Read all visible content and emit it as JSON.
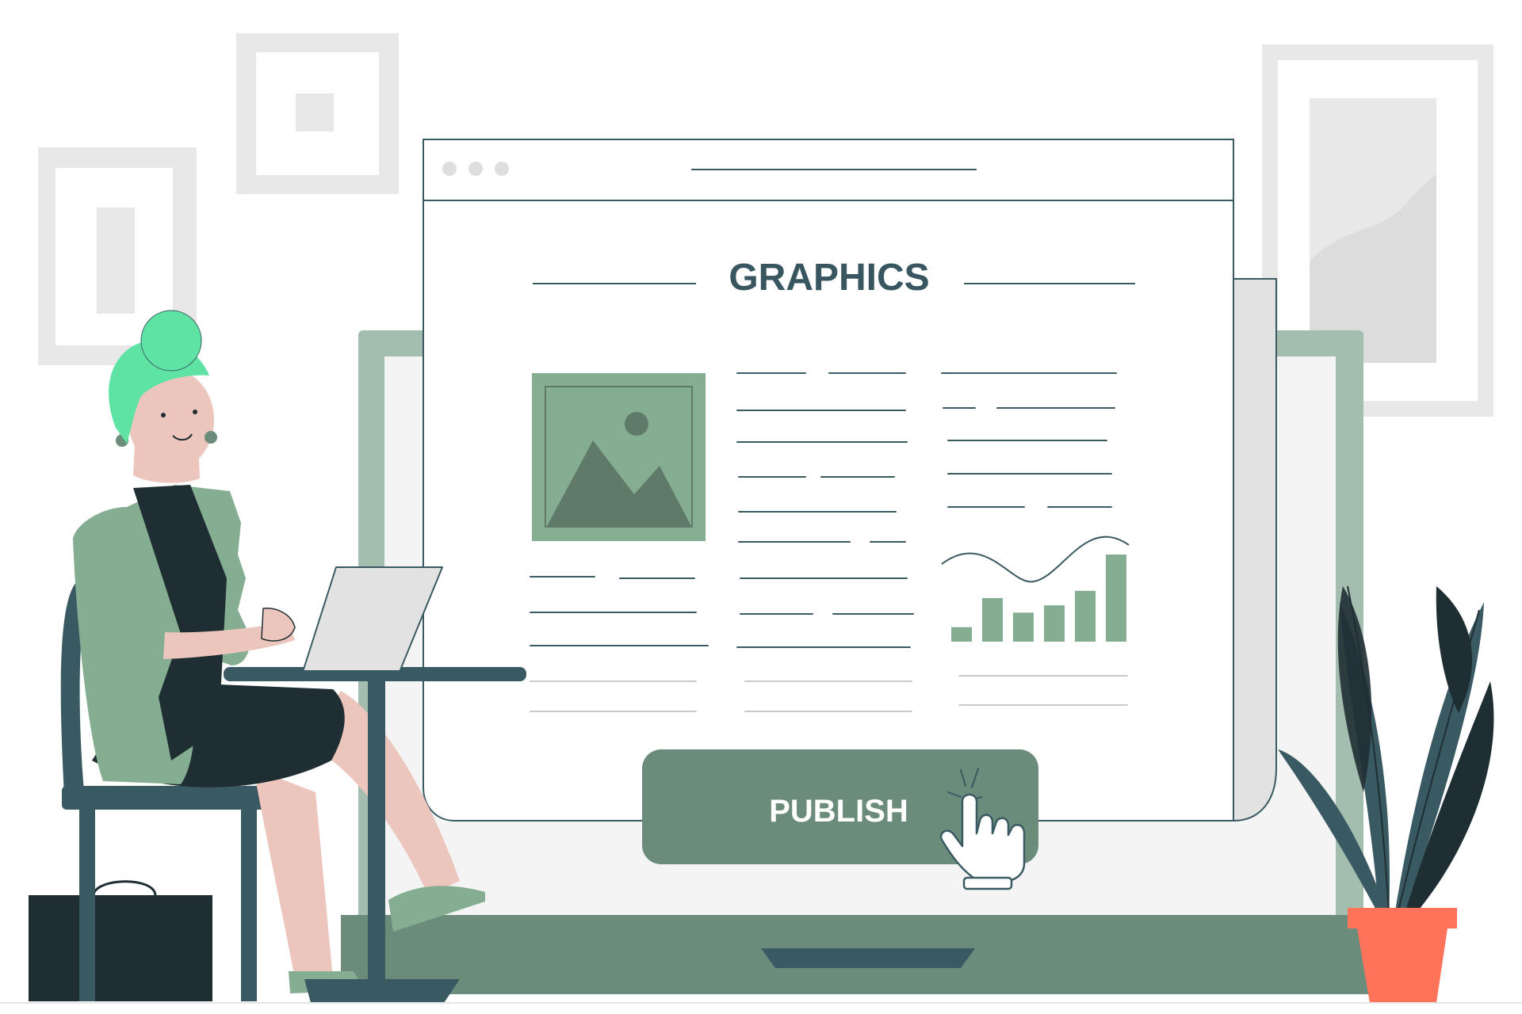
{
  "page": {
    "heading": "GRAPHICS",
    "publish_label": "PUBLISH"
  },
  "colors": {
    "heading_text": "#37565f",
    "sage": "#84ad91",
    "sage_dark": "#5f7a68",
    "monitor_frame": "#a3beaf",
    "monitor_base": "#6b8b7b",
    "button_fill": "#6b8b7b",
    "button_text": "#ffffff",
    "dark_teal": "#3a5a63",
    "ink": "#1f2e33",
    "mint": "#5ee3a4",
    "skin": "#ecc5bd",
    "pot": "#ff735a",
    "frame_gray": "#e8e8e8"
  },
  "chart_data": {
    "type": "bar",
    "values": [
      2,
      6,
      4,
      5,
      7,
      12
    ]
  },
  "icons": {
    "window_dots": "three-dots-icon",
    "image_placeholder": "image-icon",
    "cursor": "hand-pointer-icon"
  }
}
